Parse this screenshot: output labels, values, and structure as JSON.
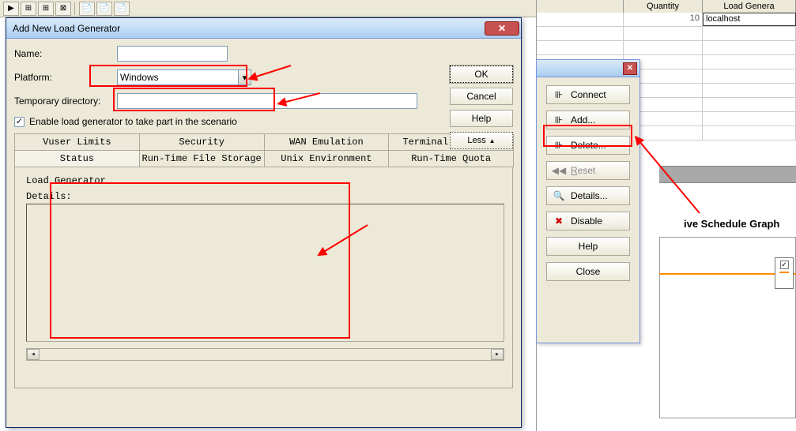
{
  "bg": {
    "columns": {
      "quantity": "Quantity",
      "load_gen": "Load Genera"
    },
    "row1_qty": "10",
    "row1_gen": "localhost",
    "graph_title": "ive Schedule Graph"
  },
  "dialog": {
    "title": "Add New Load Generator",
    "labels": {
      "name": "Name:",
      "platform": "Platform:",
      "tempdir": "Temporary directory:"
    },
    "fields": {
      "name": "",
      "platform": "Windows",
      "tempdir": ""
    },
    "checkbox_label": "Enable load generator to take part in the scenario",
    "checkbox_checked": "✓",
    "buttons": {
      "ok": "OK",
      "cancel": "Cancel",
      "help": "Help",
      "less": "Less",
      "less_arrow": "▲"
    },
    "tabs1": [
      "Vuser Limits",
      "Security",
      "WAN Emulation",
      "Terminal Services"
    ],
    "tabs2": [
      "Status",
      "Run-Time File Storage",
      "Unix Environment",
      "Run-Time Quota"
    ],
    "status_header": "Load Generator",
    "details_label": "Details:"
  },
  "panel": {
    "buttons": {
      "connect": "Connect",
      "add": "Add...",
      "delete": "Delete...",
      "reset": "Reset",
      "details": "Details...",
      "disable": "Disable",
      "help": "Help",
      "close": "Close"
    },
    "icons": {
      "connect": "⊪",
      "add": "⊪",
      "delete": "⊪",
      "reset": "◀◀",
      "details": "🔍",
      "disable": "✖"
    }
  }
}
